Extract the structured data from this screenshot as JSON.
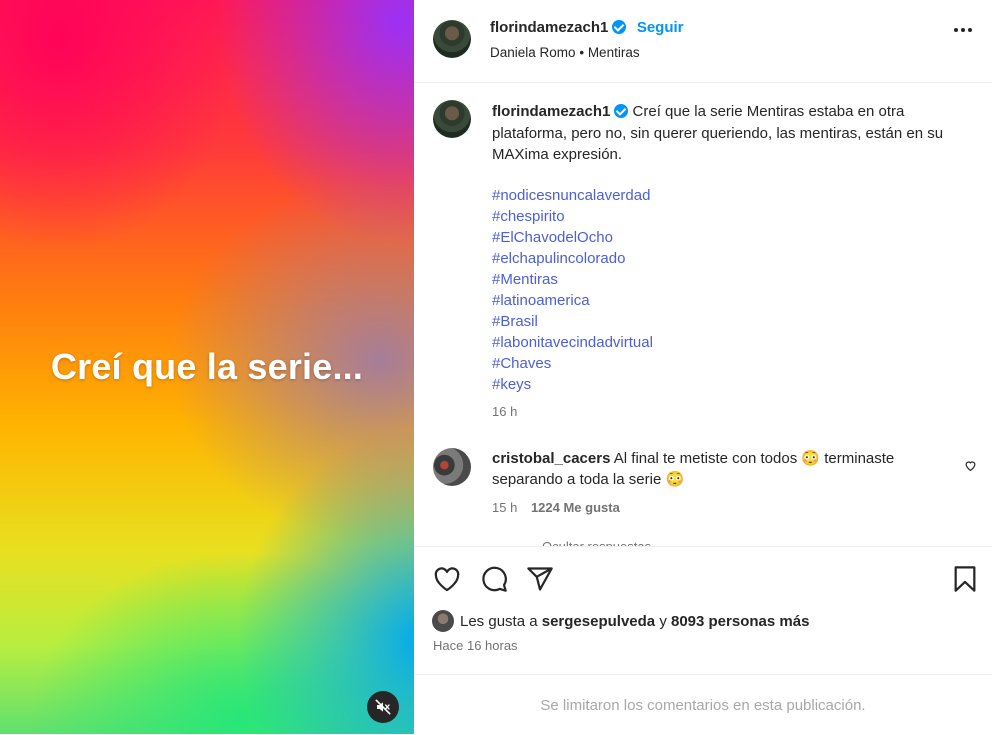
{
  "media": {
    "overlay_text": "Creí que la serie...",
    "mute_icon": "speaker-muted-icon"
  },
  "header": {
    "username": "florindamezach1",
    "follow_label": "Seguir",
    "audio_artist": "Daniela Romo",
    "audio_separator": "•",
    "audio_track": "Mentiras",
    "more_icon": "more-options-icon"
  },
  "caption": {
    "username": "florindamezach1",
    "text": "Creí que la serie Mentiras estaba en otra plataforma, pero no, sin querer queriendo, las mentiras, están en su MAXima expresión.",
    "hashtags": [
      "#nodicesnuncalaverdad",
      "#chespirito",
      "#ElChavodelOcho",
      "#elchapulincolorado",
      "#Mentiras",
      "#latinoamerica",
      "#Brasil",
      "#labonitavecindadvirtual",
      "#Chaves",
      "#keys"
    ],
    "time": "16 h"
  },
  "comment": {
    "username": "cristobal_cacers",
    "text_part1": "Al final te metiste con todos",
    "emoji1": "😳",
    "text_part2": "terminaste separando a toda la serie",
    "emoji2": "😳",
    "time": "15 h",
    "likes": "1224 Me gusta",
    "faded_text": "Ocultar respuestas"
  },
  "actions": {
    "like_icon": "heart-icon",
    "comment_icon": "comment-icon",
    "share_icon": "share-icon",
    "save_icon": "bookmark-icon"
  },
  "likes": {
    "prefix": "Les gusta a",
    "user": "sergesepulveda",
    "joiner": "y",
    "others": "8093 personas más"
  },
  "posted_ago": "Hace 16 horas",
  "footer_note": "Se limitaron los comentarios en esta publicación.",
  "colors": {
    "link_blue": "#0095f6",
    "hashtag": "#4c5fd5",
    "muted": "#737373"
  }
}
